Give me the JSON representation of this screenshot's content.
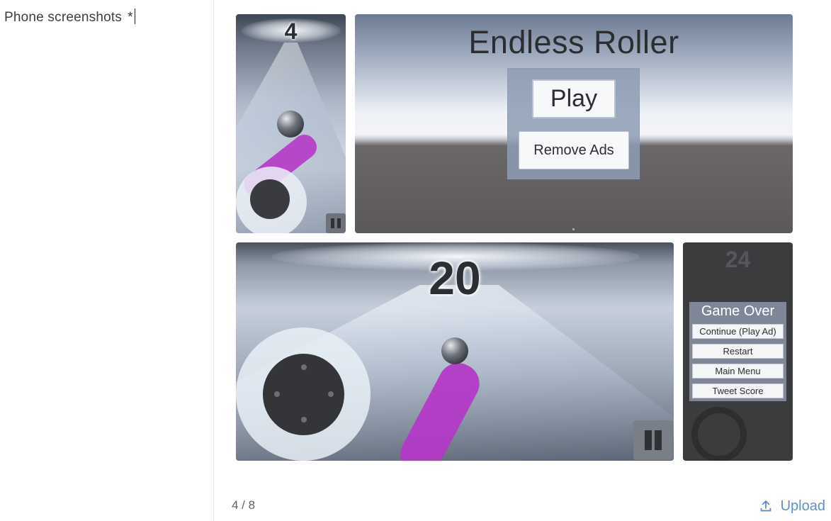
{
  "field": {
    "label": "Phone screenshots",
    "required_mark": "*"
  },
  "screenshots": [
    {
      "score": "4"
    },
    {
      "title": "Endless Roller",
      "play_label": "Play",
      "remove_ads_label": "Remove Ads"
    },
    {
      "score": "20"
    },
    {
      "score": "24",
      "heading": "Game Over",
      "buttons": [
        "Continue (Play Ad)",
        "Restart",
        "Main Menu",
        "Tweet Score"
      ]
    }
  ],
  "counter": "4 / 8",
  "upload": {
    "label": "Upload",
    "icon": "upload-icon"
  },
  "colors": {
    "accent": "#5f8fc7",
    "trail": "#b53cc8"
  }
}
